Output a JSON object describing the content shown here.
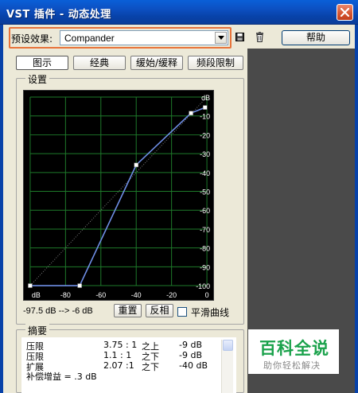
{
  "window": {
    "title": "VST 插件 - 动态处理",
    "close_icon": "close-x-icon"
  },
  "toolbar": {
    "preset_label": "预设效果:",
    "preset_value": "Compander",
    "help_label": "帮助",
    "save_icon": "floppy-disk-icon",
    "delete_icon": "trash-can-icon"
  },
  "tabs": [
    {
      "label": "图示",
      "active": true
    },
    {
      "label": "经典",
      "active": false
    },
    {
      "label": "缓始/缓释",
      "active": false
    },
    {
      "label": "频段限制",
      "active": false
    }
  ],
  "settings": {
    "group_title": "设置",
    "range_text": "-97.5 dB --> -6 dB",
    "reset_label": "重置",
    "invert_label": "反相",
    "smooth_label": "平滑曲线",
    "smooth_checked": false
  },
  "chart_data": {
    "type": "line",
    "x_ticks": [
      "dB",
      "-80",
      "-60",
      "-40",
      "-20",
      "0"
    ],
    "y_ticks": [
      "dB",
      "-10",
      "-20",
      "-30",
      "-40",
      "-50",
      "-60",
      "-70",
      "-80",
      "-90",
      "-100"
    ],
    "xlim": [
      -100,
      0
    ],
    "ylim": [
      -100,
      0
    ],
    "grid": true,
    "line_color": "#6f8fe6",
    "grid_color": "#1e7a2a",
    "points": [
      {
        "x": -100,
        "y": -100
      },
      {
        "x": -72,
        "y": -100
      },
      {
        "x": -40,
        "y": -36
      },
      {
        "x": -9,
        "y": -8.5
      },
      {
        "x": -1,
        "y": -5.5
      }
    ]
  },
  "summary": {
    "group_title": "摘要",
    "rows": [
      {
        "type": "压限",
        "ratio": "3.75 : 1",
        "where": "之上",
        "threshold": "-9 dB"
      },
      {
        "type": "压限",
        "ratio": "1.1 : 1",
        "where": "之下",
        "threshold": "-9 dB"
      },
      {
        "type": "扩展",
        "ratio": "2.07 :1",
        "where": "之下",
        "threshold": "-40 dB"
      }
    ],
    "makeup_gain": "补偿增益 = .3 dB"
  },
  "watermark": {
    "title": "百科全说",
    "subtitle": "助你轻松解决"
  }
}
